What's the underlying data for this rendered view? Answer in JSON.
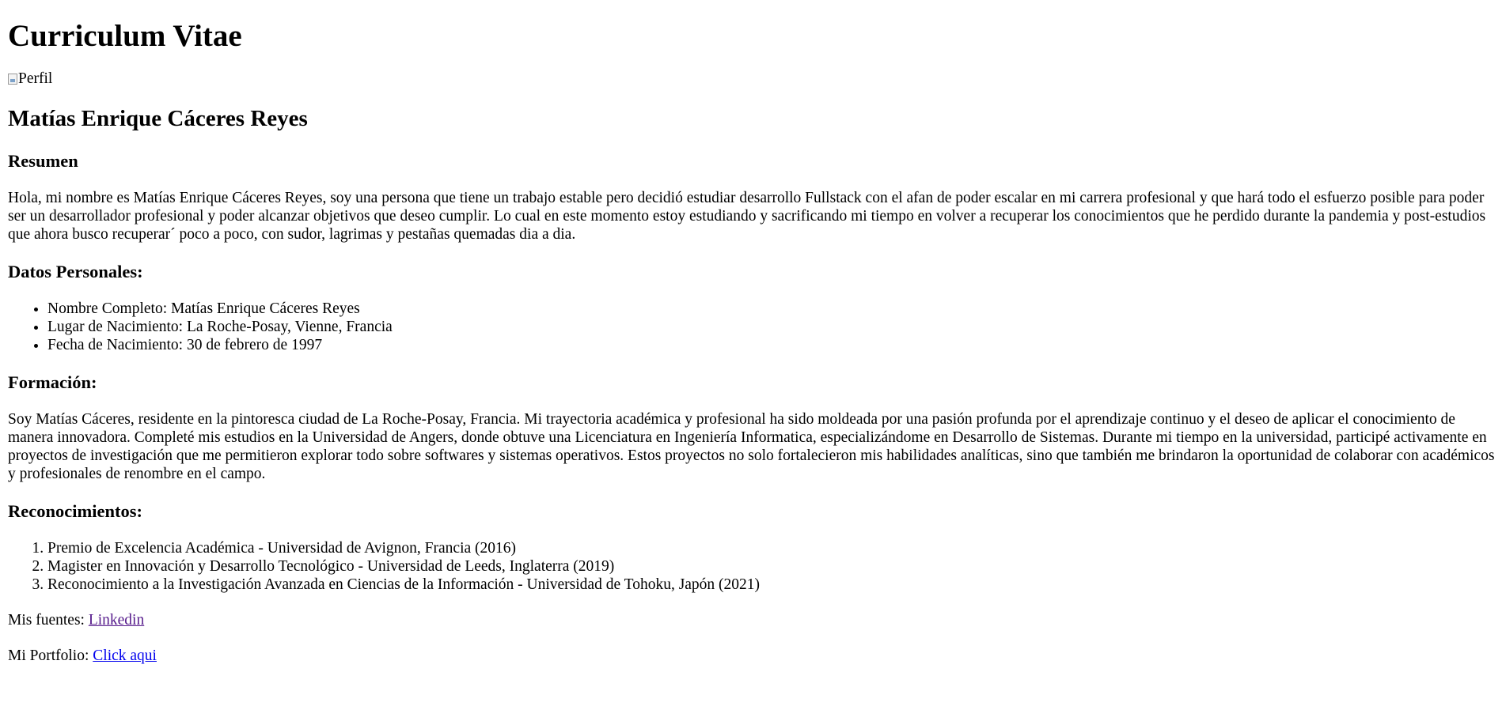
{
  "page": {
    "title": "Curriculum Vitae",
    "profile_image_alt": "Perfil",
    "name": "Matías Enrique Cáceres Reyes"
  },
  "resumen": {
    "heading": "Resumen",
    "text": "Hola, mi nombre es Matías Enrique Cáceres Reyes, soy una persona que tiene un trabajo estable pero decidió estudiar desarrollo Fullstack con el afan de poder escalar en mi carrera profesional y que hará todo el esfuerzo posible para poder ser un desarrollador profesional y poder alcanzar objetivos que deseo cumplir. Lo cual en este momento estoy estudiando y sacrificando mi tiempo en volver a recuperar los conocimientos que he perdido durante la pandemia y post-estudios que ahora busco recuperar´ poco a poco, con sudor, lagrimas y pestañas quemadas dia a dia."
  },
  "datos_personales": {
    "heading": "Datos Personales:",
    "items": [
      "Nombre Completo: Matías Enrique Cáceres Reyes",
      "Lugar de Nacimiento: La Roche-Posay, Vienne, Francia",
      "Fecha de Nacimiento: 30 de febrero de 1997"
    ]
  },
  "formacion": {
    "heading": "Formación:",
    "text": "Soy Matías Cáceres, residente en la pintoresca ciudad de La Roche-Posay, Francia. Mi trayectoria académica y profesional ha sido moldeada por una pasión profunda por el aprendizaje continuo y el deseo de aplicar el conocimiento de manera innovadora. Completé mis estudios en la Universidad de Angers, donde obtuve una Licenciatura en Ingeniería Informatica, especializándome en Desarrollo de Sistemas. Durante mi tiempo en la universidad, participé activamente en proyectos de investigación que me permitieron explorar todo sobre softwares y sistemas operativos. Estos proyectos no solo fortalecieron mis habilidades analíticas, sino que también me brindaron la oportunidad de colaborar con académicos y profesionales de renombre en el campo."
  },
  "reconocimientos": {
    "heading": "Reconocimientos:",
    "items": [
      "Premio de Excelencia Académica - Universidad de Avignon, Francia (2016)",
      "Magister en Innovación y Desarrollo Tecnológico - Universidad de Leeds, Inglaterra (2019)",
      "Reconocimiento a la Investigación Avanzada en Ciencias de la Información - Universidad de Tohoku, Japón (2021)"
    ]
  },
  "links": {
    "fuentes_label": "Mis fuentes: ",
    "fuentes_link": "Linkedin",
    "portfolio_label": "Mi Portfolio: ",
    "portfolio_link": "Click aqui",
    "visited_color": "#551a8b",
    "unvisited_color": "#0000ee"
  }
}
